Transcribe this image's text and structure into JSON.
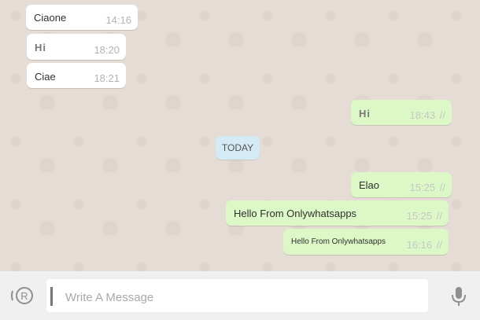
{
  "messages": [
    {
      "text": "Ciaone",
      "time": "14:16"
    },
    {
      "text": "Hi",
      "time": "18:20"
    },
    {
      "text": "Ciae",
      "time": "18:21"
    },
    {
      "text": "Hi",
      "time": "18:43",
      "ticks": "//"
    },
    {
      "text": "Elao",
      "time": "15:25",
      "ticks": "//"
    },
    {
      "text": "Hello From Onlywhatsapps",
      "time": "15:25",
      "ticks": "//"
    },
    {
      "text": "Hello From Onlywhatsapps",
      "time": "16:16",
      "ticks": "//"
    }
  ],
  "day_separator": "TODAY",
  "composer": {
    "placeholder": "Write A Message"
  },
  "icons": {
    "emoji": "emoji-icon",
    "mic": "mic-icon"
  },
  "colors": {
    "incoming": "#ffffff",
    "outgoing": "#dcf8c6",
    "background": "#e5ddd5",
    "day_badge": "#d4eaf4"
  }
}
